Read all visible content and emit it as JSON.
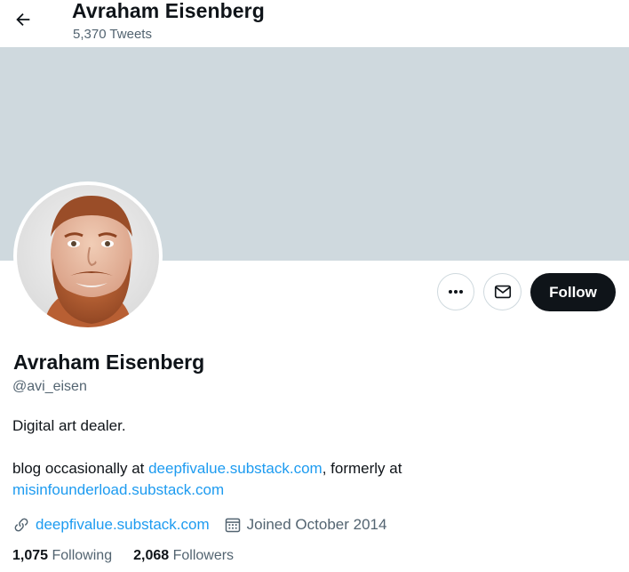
{
  "header": {
    "title": "Avraham Eisenberg",
    "tweet_count": "5,370 Tweets",
    "back_icon": "arrow-left-icon"
  },
  "profile": {
    "display_name": "Avraham Eisenberg",
    "handle": "@avi_eisen",
    "bio_line1": "Digital art dealer.",
    "bio_line2_prefix": "blog occasionally at ",
    "bio_link1": "deepfivalue.substack.com",
    "bio_line2_middle": ", formerly at",
    "bio_link2": "misinfounderload.substack.com",
    "website": "deepfivalue.substack.com",
    "joined": "Joined October 2014",
    "following_count": "1,075",
    "following_label": "Following",
    "followers_count": "2,068",
    "followers_label": "Followers"
  },
  "actions": {
    "follow_label": "Follow",
    "more_icon": "more-horizontal-icon",
    "message_icon": "envelope-icon"
  },
  "colors": {
    "banner": "#cfd9de",
    "link": "#1d9bf0",
    "secondary_text": "#536471",
    "follow_bg": "#0f1419"
  }
}
